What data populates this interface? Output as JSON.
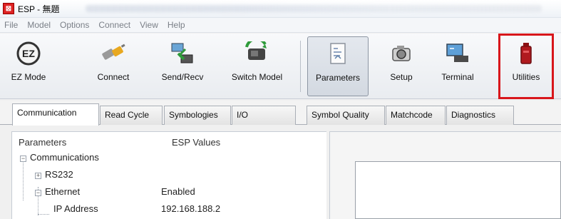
{
  "window": {
    "title": "ESP - 無題",
    "app_icon": "esp-app-icon"
  },
  "menu": [
    "File",
    "Model",
    "Options",
    "Connect",
    "View",
    "Help"
  ],
  "toolbar": {
    "buttons": [
      {
        "label": "EZ Mode",
        "icon": "ez-mode-icon"
      },
      {
        "label": "Connect",
        "icon": "connect-plug-icon"
      },
      {
        "label": "Send/Recv",
        "icon": "send-recv-icon"
      },
      {
        "label": "Switch Model",
        "icon": "switch-model-icon"
      },
      {
        "label": "Parameters",
        "icon": "parameters-icon",
        "active": true
      },
      {
        "label": "Setup",
        "icon": "camera-setup-icon"
      },
      {
        "label": "Terminal",
        "icon": "terminal-icon"
      },
      {
        "label": "Utilities",
        "icon": "utilities-icon",
        "highlighted": true
      }
    ],
    "highlight_color": "#d8161b"
  },
  "tabs": [
    {
      "label": "Communication",
      "selected": true
    },
    {
      "label": "Read Cycle"
    },
    {
      "label": "Symbologies"
    },
    {
      "label": "I/O"
    },
    {
      "label": "Symbol Quality"
    },
    {
      "label": "Matchcode"
    },
    {
      "label": "Diagnostics"
    }
  ],
  "tree": {
    "columns": [
      "Parameters",
      "ESP Values"
    ],
    "rows": [
      {
        "label": "Communications",
        "value": ""
      },
      {
        "label": "RS232",
        "value": ""
      },
      {
        "label": "Ethernet",
        "value": "Enabled"
      },
      {
        "label": "IP Address",
        "value": "192.168.188.2"
      }
    ]
  }
}
